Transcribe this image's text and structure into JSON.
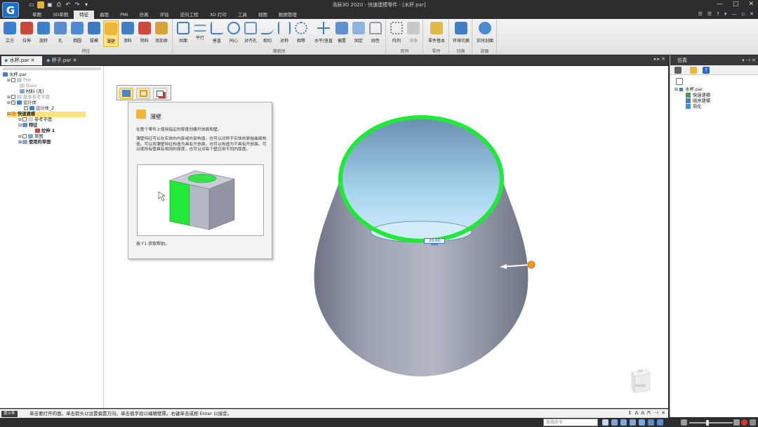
{
  "window": {
    "title": "浩辰3D 2020 - 快速建模零件 - [水杯.par]",
    "logo": "G"
  },
  "menu_tabs": [
    "草图",
    "3D草图",
    "特征",
    "曲面",
    "PMI",
    "仿真",
    "评估",
    "逆向工程",
    "3D 打印",
    "工具",
    "视图",
    "数据管理"
  ],
  "active_tab": "特征",
  "ribbon": {
    "feature_group": {
      "title": "特征",
      "buttons": [
        "立方",
        "拉伸",
        "旋转",
        "孔",
        "倒圆",
        "拔模",
        "薄壁",
        "添料",
        "除料",
        "添加体"
      ]
    },
    "plane_group": {
      "title": "面相关",
      "buttons": [
        "共面",
        "平行",
        "垂直",
        "同心",
        "对齐孔",
        "相切",
        "对称",
        "相等",
        "水平/竖直",
        "偏置",
        "固定",
        "刚性"
      ]
    },
    "pattern_group": {
      "title": "阵列",
      "buttons": [
        "阵列",
        "镜像"
      ]
    },
    "part_group": {
      "title": "零件",
      "buttons": [
        "零件基本"
      ]
    },
    "switch_group": {
      "title": "切换",
      "buttons": [
        "环境切换"
      ]
    },
    "section_group": {
      "title": "剖面",
      "buttons": [
        "实时剖面"
      ]
    }
  },
  "doc_tabs": [
    "水杯.par",
    "杯子.par"
  ],
  "tree": {
    "root": "水杯.par",
    "nodes": [
      "PMI",
      "Base",
      "材料 (无)",
      "基本参考平面",
      "设计体",
      "设计体_2",
      "快速建模",
      "参考平面",
      "特征",
      "拉伸 1",
      "草图",
      "使用的草图"
    ]
  },
  "flyout": [
    "薄壁",
    "加厚",
    "环形"
  ],
  "tooltip": {
    "title": "薄壁",
    "line1": "在整个零件上使用指定的厚度创建开放面和壁。",
    "line2": "薄壁特征可以在实体的内部或外部构造，也可以对称于实体的原始曲面构造。可以将薄壁特征构造为具有开放面，也可以构造为不具有开放面。可以使所有壁具有相同的厚度，也可以对每个壁应用不同的厚度。",
    "help": "按 F1 获取帮助。"
  },
  "dimension": "20.00 mm",
  "viewcube": {
    "top": "TOP",
    "front": "FRONT"
  },
  "right_panel": {
    "title": "仿真",
    "root": "水杯.par",
    "items": [
      "快速建模",
      "顺序建模",
      "简化"
    ]
  },
  "status": {
    "badge": "提示条",
    "text": "单击要打开的面。单击箭头以设置偏置方向。单击值字段以编辑壁厚。右键单击或按 Enter 以接受。"
  },
  "command_finder": {
    "placeholder": "查找命令"
  },
  "colors": {
    "accent_green": "#22e83a",
    "body": "#8f96a6",
    "interior": "#a9d8f2",
    "selected_button": "#fde37c"
  }
}
